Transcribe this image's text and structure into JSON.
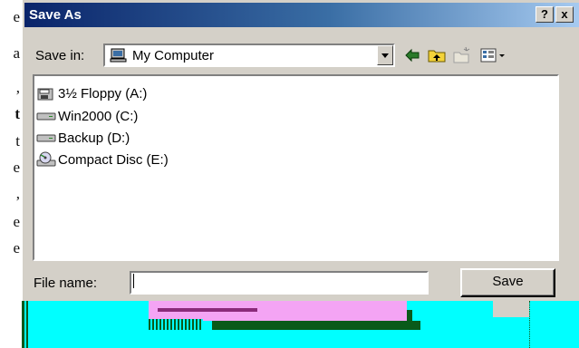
{
  "background_text": [
    "e",
    "a",
    ",",
    "t",
    "t",
    "e",
    ",",
    "e",
    "e"
  ],
  "dialog": {
    "title": "Save As",
    "help_button": "?",
    "close_button": "x",
    "save_in_label": "Save in:",
    "save_in_value": "My Computer",
    "file_list": [
      {
        "label": "3½ Floppy (A:)",
        "icon": "floppy-drive-icon"
      },
      {
        "label": "Win2000 (C:)",
        "icon": "hard-drive-icon"
      },
      {
        "label": "Backup (D:)",
        "icon": "hard-drive-icon"
      },
      {
        "label": "Compact Disc (E:)",
        "icon": "cd-drive-icon"
      }
    ],
    "file_name_label": "File name:",
    "file_name_value": "",
    "save_button": "Save"
  },
  "colors": {
    "title_bar_start": "#0a246a",
    "title_bar_end": "#a6caf0",
    "dialog_face": "#d4d0c8",
    "glitch_cyan": "#00ffff",
    "glitch_pink": "#f4a4f4",
    "glitch_green": "#0a5a1a"
  }
}
